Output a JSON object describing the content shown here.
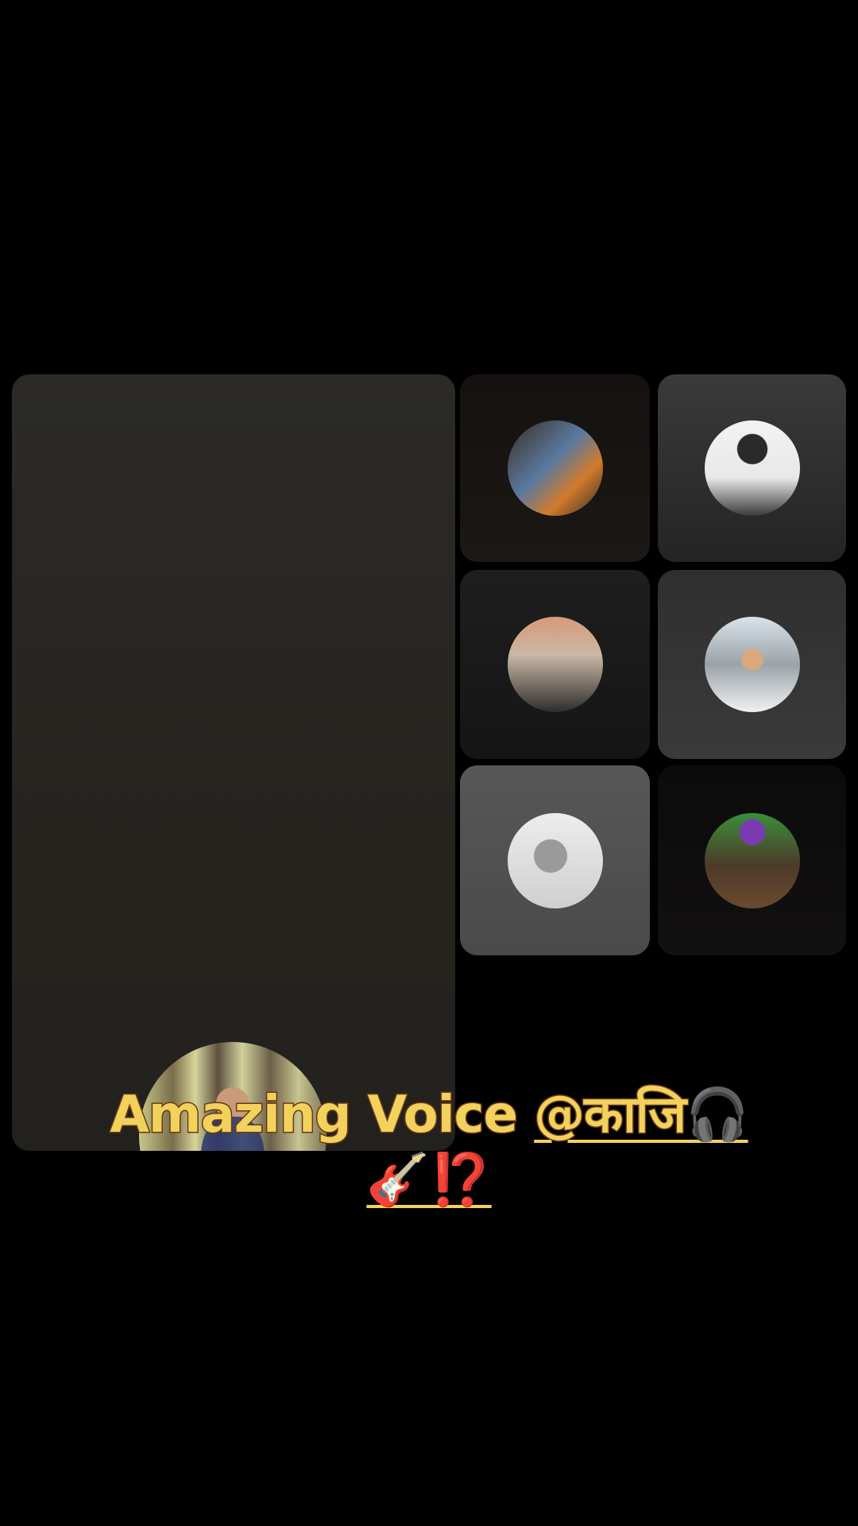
{
  "main_participant": {
    "avatar": "guitar-player-in-forest-avatar"
  },
  "participants": [
    {
      "avatar": "group-photo-avatar"
    },
    {
      "avatar": "man-with-guitar-avatar"
    },
    {
      "avatar": "man-in-red-cap-avatar"
    },
    {
      "avatar": "woman-in-sunglasses-avatar"
    },
    {
      "avatar": "sketch-singer-avatar"
    },
    {
      "avatar": "person-in-green-avatar"
    }
  ],
  "caption": {
    "text": "Amazing Voice ",
    "mention": "@काजि🎧",
    "line2": "🎸⁉️"
  }
}
